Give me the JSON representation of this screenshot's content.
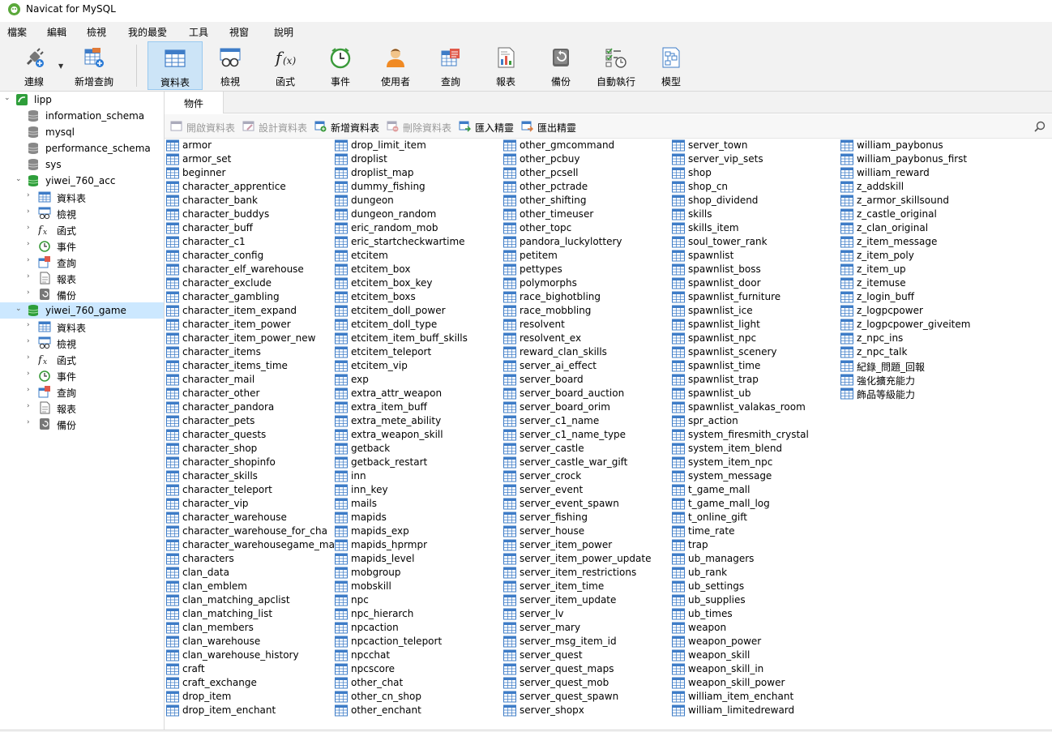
{
  "window": {
    "title": "Navicat for MySQL"
  },
  "menu": [
    "檔案",
    "編輯",
    "檢視",
    "我的最愛",
    "工具",
    "視窗",
    "說明"
  ],
  "toolbar": [
    {
      "label": "連線",
      "icon": "connection-plug-icon"
    },
    {
      "label": "新增查詢",
      "icon": "new-query-icon"
    },
    {
      "label": "資料表",
      "icon": "table-icon",
      "active": true
    },
    {
      "label": "檢視",
      "icon": "view-glasses-icon"
    },
    {
      "label": "函式",
      "icon": "function-fx-icon"
    },
    {
      "label": "事件",
      "icon": "event-clock-icon"
    },
    {
      "label": "使用者",
      "icon": "user-icon"
    },
    {
      "label": "查詢",
      "icon": "query-icon"
    },
    {
      "label": "報表",
      "icon": "report-icon"
    },
    {
      "label": "備份",
      "icon": "backup-icon"
    },
    {
      "label": "自動執行",
      "icon": "schedule-icon"
    },
    {
      "label": "模型",
      "icon": "model-icon"
    }
  ],
  "colors": {
    "accent": "#cce4f7",
    "selected_row": "#cce8ff",
    "db_green": "#2e9e3a",
    "table_blue": "#3e7cc7"
  },
  "sidebar": {
    "connection": "lipp",
    "databases": [
      "information_schema",
      "mysql",
      "performance_schema",
      "sys"
    ],
    "db_acc": {
      "name": "yiwei_760_acc",
      "children": [
        "資料表",
        "檢視",
        "函式",
        "事件",
        "查詢",
        "報表",
        "備份"
      ]
    },
    "db_game": {
      "name": "yiwei_760_game",
      "children": [
        "資料表",
        "檢視",
        "函式",
        "事件",
        "查詢",
        "報表",
        "備份"
      ]
    }
  },
  "tabs": {
    "objects": "物件"
  },
  "objbar": {
    "open": "開啟資料表",
    "design": "設計資料表",
    "new": "新增資料表",
    "delete": "刪除資料表",
    "import": "匯入精靈",
    "export": "匯出精靈"
  },
  "tables": {
    "col1": [
      "armor",
      "armor_set",
      "beginner",
      "character_apprentice",
      "character_bank",
      "character_buddys",
      "character_buff",
      "character_c1",
      "character_config",
      "character_elf_warehouse",
      "character_exclude",
      "character_gambling",
      "character_item_expand",
      "character_item_power",
      "character_item_power_new",
      "character_items",
      "character_items_time",
      "character_mail",
      "character_other",
      "character_pandora",
      "character_pets",
      "character_quests",
      "character_shop",
      "character_shopinfo",
      "character_skills",
      "character_teleport",
      "character_vip",
      "character_warehouse",
      "character_warehouse_for_cha",
      "character_warehousegame_mall",
      "characters",
      "clan_data",
      "clan_emblem",
      "clan_matching_apclist",
      "clan_matching_list",
      "clan_members",
      "clan_warehouse",
      "clan_warehouse_history",
      "craft",
      "craft_exchange",
      "drop_item",
      "drop_item_enchant"
    ],
    "col2": [
      "drop_limit_item",
      "droplist",
      "droplist_map",
      "dummy_fishing",
      "dungeon",
      "dungeon_random",
      "eric_random_mob",
      "eric_startcheckwartime",
      "etcitem",
      "etcitem_box",
      "etcitem_box_key",
      "etcitem_boxs",
      "etcitem_doll_power",
      "etcitem_doll_type",
      "etcitem_item_buff_skills",
      "etcitem_teleport",
      "etcitem_vip",
      "exp",
      "extra_attr_weapon",
      "extra_item_buff",
      "extra_mete_ability",
      "extra_weapon_skill",
      "getback",
      "getback_restart",
      "inn",
      "inn_key",
      "mails",
      "mapids",
      "mapids_exp",
      "mapids_hprmpr",
      "mapids_level",
      "mobgroup",
      "mobskill",
      "npc",
      "npc_hierarch",
      "npcaction",
      "npcaction_teleport",
      "npcchat",
      "npcscore",
      "other_chat",
      "other_cn_shop",
      "other_enchant"
    ],
    "col3": [
      "other_gmcommand",
      "other_pcbuy",
      "other_pcsell",
      "other_pctrade",
      "other_shifting",
      "other_timeuser",
      "other_topc",
      "pandora_luckylottery",
      "petitem",
      "pettypes",
      "polymorphs",
      "race_bighotbling",
      "race_mobbling",
      "resolvent",
      "resolvent_ex",
      "reward_clan_skills",
      "server_ai_effect",
      "server_board",
      "server_board_auction",
      "server_board_orim",
      "server_c1_name",
      "server_c1_name_type",
      "server_castle",
      "server_castle_war_gift",
      "server_crock",
      "server_event",
      "server_event_spawn",
      "server_fishing",
      "server_house",
      "server_item_power",
      "server_item_power_update",
      "server_item_restrictions",
      "server_item_time",
      "server_item_update",
      "server_lv",
      "server_mary",
      "server_msg_item_id",
      "server_quest",
      "server_quest_maps",
      "server_quest_mob",
      "server_quest_spawn",
      "server_shopx"
    ],
    "col4": [
      "server_town",
      "server_vip_sets",
      "shop",
      "shop_cn",
      "shop_dividend",
      "skills",
      "skills_item",
      "soul_tower_rank",
      "spawnlist",
      "spawnlist_boss",
      "spawnlist_door",
      "spawnlist_furniture",
      "spawnlist_ice",
      "spawnlist_light",
      "spawnlist_npc",
      "spawnlist_scenery",
      "spawnlist_time",
      "spawnlist_trap",
      "spawnlist_ub",
      "spawnlist_valakas_room",
      "spr_action",
      "system_firesmith_crystal",
      "system_item_blend",
      "system_item_npc",
      "system_message",
      "t_game_mall",
      "t_game_mall_log",
      "t_online_gift",
      "time_rate",
      "trap",
      "ub_managers",
      "ub_rank",
      "ub_settings",
      "ub_supplies",
      "ub_times",
      "weapon",
      "weapon_power",
      "weapon_skill",
      "weapon_skill_in",
      "weapon_skill_power",
      "william_item_enchant",
      "william_limitedreward"
    ],
    "col5": [
      "william_paybonus",
      "william_paybonus_first",
      "william_reward",
      "z_addskill",
      "z_armor_skillsound",
      "z_castle_original",
      "z_clan_original",
      "z_item_message",
      "z_item_poly",
      "z_item_up",
      "z_itemuse",
      "z_login_buff",
      "z_logpcpower",
      "z_logpcpower_giveitem",
      "z_npc_ins",
      "z_npc_talk",
      "紀錄_問題_回報",
      "強化擴充能力",
      "飾品等級能力"
    ]
  }
}
